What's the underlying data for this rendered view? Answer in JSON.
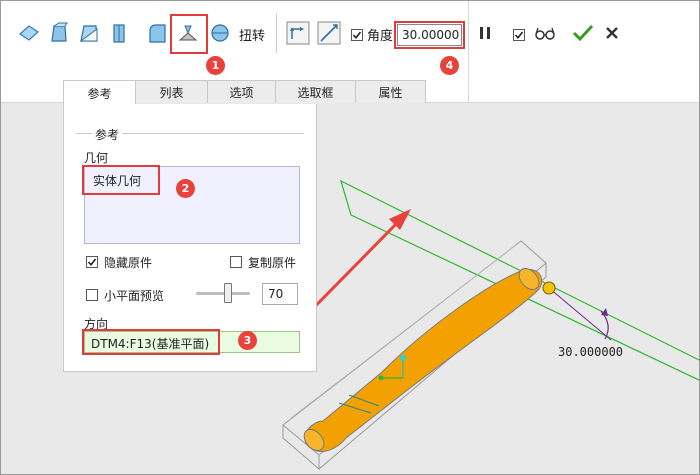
{
  "toolbar": {
    "twist_label": "扭转",
    "angle_label": "角度",
    "angle_value": "30.00000",
    "angle_checked": true,
    "preview_checked": true,
    "icons": [
      "surface-icon",
      "solid-icon",
      "slice-icon",
      "thicken-icon",
      "corner-icon",
      "draft-icon",
      "round-solid-icon",
      "flip-direction-icon",
      "diagonal-icon",
      "pause-icon",
      "preview-glasses-icon",
      "confirm-icon",
      "cancel-icon"
    ]
  },
  "callouts": [
    "1",
    "2",
    "3",
    "4"
  ],
  "tabs": [
    {
      "label": "参考",
      "active": true
    },
    {
      "label": "列表",
      "active": false
    },
    {
      "label": "选项",
      "active": false
    },
    {
      "label": "选取框",
      "active": false
    },
    {
      "label": "属性",
      "active": false
    }
  ],
  "panel": {
    "group_title": "参考",
    "geometry_label": "几何",
    "geometry_value": "实体几何",
    "hide_original_label": "隐藏原件",
    "hide_original_checked": true,
    "copy_original_label": "复制原件",
    "copy_original_checked": false,
    "small_plane_label": "小平面预览",
    "small_plane_checked": false,
    "slider_value": "70",
    "direction_label": "方向",
    "direction_value": "DTM4:F13(基准平面)"
  },
  "viewport": {
    "angle_annotation": "30.000000",
    "colors": {
      "part": "#f2a100",
      "plane": "#2db82d",
      "arrow": "#e8423c"
    }
  }
}
